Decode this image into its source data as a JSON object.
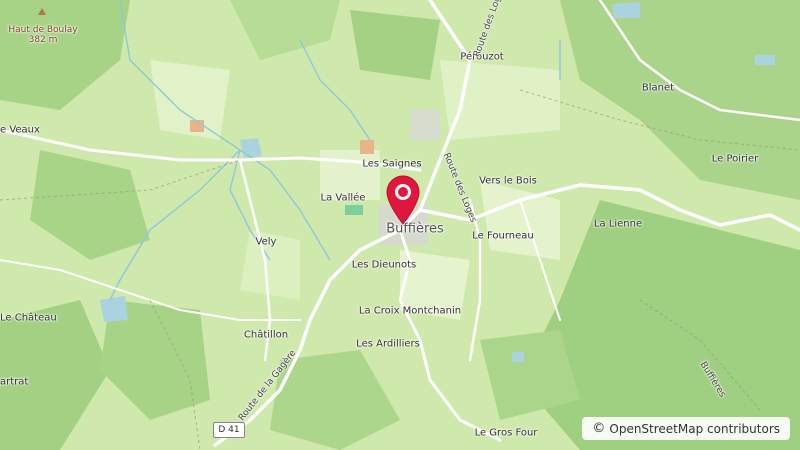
{
  "map": {
    "peak": {
      "name": "Haut de Boulay",
      "elevation": "382 m"
    },
    "places": {
      "veaux": "e Veaux",
      "perouzot": "Pérouzot",
      "blanet": "Blanet",
      "les_saignes": "Les Saignes",
      "la_vallee": "La Vallée",
      "vers_le_bois": "Vers le Bois",
      "le_poirier": "Le Poirier",
      "la_lienne": "La Lienne",
      "le_fourneau": "Le Fourneau",
      "buffieres": "Buffières",
      "vely": "Vely",
      "les_dieunots": "Les Dieunots",
      "le_chateau": "Le Château",
      "chatillon": "Châtillon",
      "la_croix_montchanin": "La Croix Montchanin",
      "les_ardilliers": "Les Ardilliers",
      "artrat": "artrat",
      "le_gros_four": "Le Gros Four"
    },
    "roads": {
      "route_des_loges_top": "Route des Loges",
      "route_des_loges_mid": "Route des Loges",
      "route_de_la_gagere": "Route de la Gagère",
      "buffieres_road": "Buffières",
      "d41": "D 41"
    },
    "marker_icon": "map-pin-icon",
    "colors": {
      "marker": "#e0163c",
      "forest": "#a9d48a",
      "field": "#dcefbf",
      "road": "#ffffff"
    }
  },
  "attribution": {
    "symbol": "©",
    "text": "OpenStreetMap contributors",
    "icon": "info-icon"
  }
}
